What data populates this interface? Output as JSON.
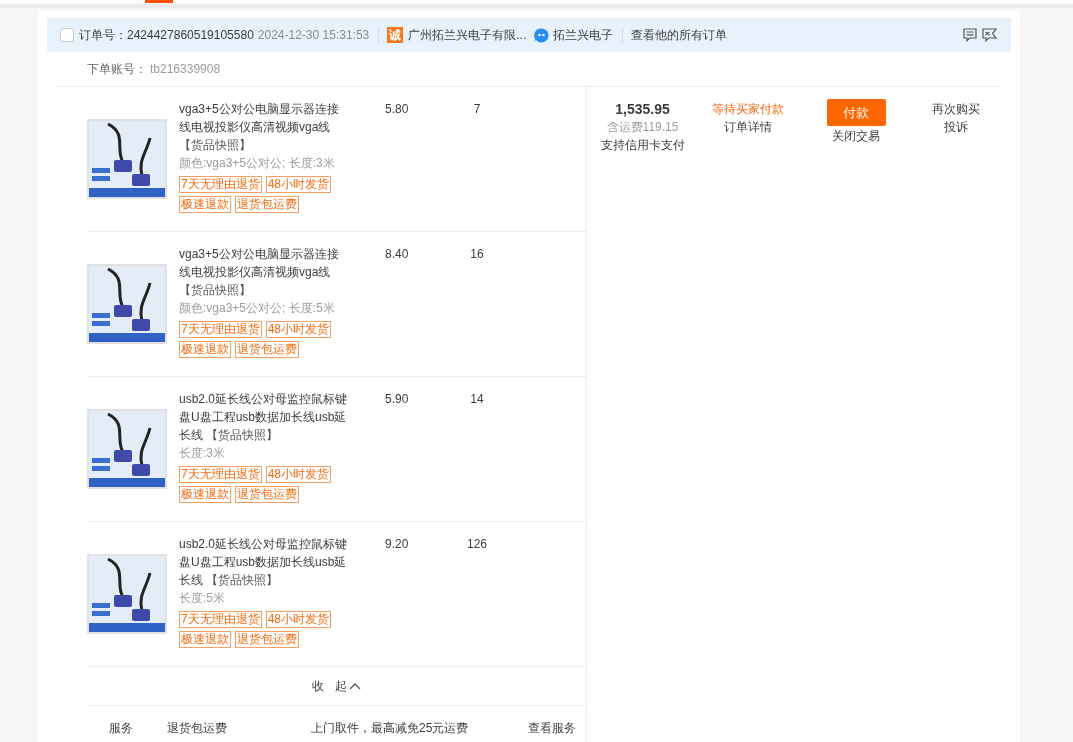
{
  "order": {
    "checked": false,
    "number_label": "订单号：",
    "number": "2424427860519105580",
    "time": "2024-12-30 15:31:53",
    "seller_badge": "诚",
    "shop_name": "广州拓兰兴电子有限...",
    "chat_name": "拓兰兴电子",
    "all_orders_link": "查看他的所有订单",
    "account_label": "下单账号：",
    "account": "tb216339908"
  },
  "items": [
    {
      "title": "vga3+5公对公电脑显示器连接线电视投影仪高清视频vga线",
      "snapshot": "【货品快照】",
      "spec": "颜色:vga3+5公对公; 长度:3米",
      "price": "5.80",
      "quantity": "7",
      "tags": [
        "7天无理由退货",
        "48小时发货",
        "极速退款",
        "退货包运费"
      ]
    },
    {
      "title": "vga3+5公对公电脑显示器连接线电视投影仪高清视频vga线",
      "snapshot": "【货品快照】",
      "spec": "颜色:vga3+5公对公; 长度:5米",
      "price": "8.40",
      "quantity": "16",
      "tags": [
        "7天无理由退货",
        "48小时发货",
        "极速退款",
        "退货包运费"
      ]
    },
    {
      "title": "usb2.0延长线公对母监控鼠标键盘U盘工程usb数据加长线usb延长线",
      "snapshot": "【货品快照】",
      "spec": "长度:3米",
      "price": "5.90",
      "quantity": "14",
      "tags": [
        "7天无理由退货",
        "48小时发货",
        "极速退款",
        "退货包运费"
      ]
    },
    {
      "title": "usb2.0延长线公对母监控鼠标键盘U盘工程usb数据加长线usb延长线",
      "snapshot": "【货品快照】",
      "spec": "长度:5米",
      "price": "9.20",
      "quantity": "126",
      "tags": [
        "7天无理由退货",
        "48小时发货",
        "极速退款",
        "退货包运费"
      ]
    }
  ],
  "summary": {
    "total": "1,535.95",
    "shipping": "含运费119.15",
    "payment_note": "支持信用卡支付"
  },
  "status": {
    "text": "等待买家付款",
    "detail_link": "订单详情"
  },
  "actions": {
    "pay_button": "付款",
    "close_link": "关闭交易"
  },
  "more": {
    "rebuy_link": "再次购买",
    "complain_link": "投诉"
  },
  "collapse_button": "收 起",
  "service": {
    "label": "服务",
    "name": "退货包运费",
    "description": "上门取件，最高减免25元运费",
    "link": "查看服务"
  }
}
